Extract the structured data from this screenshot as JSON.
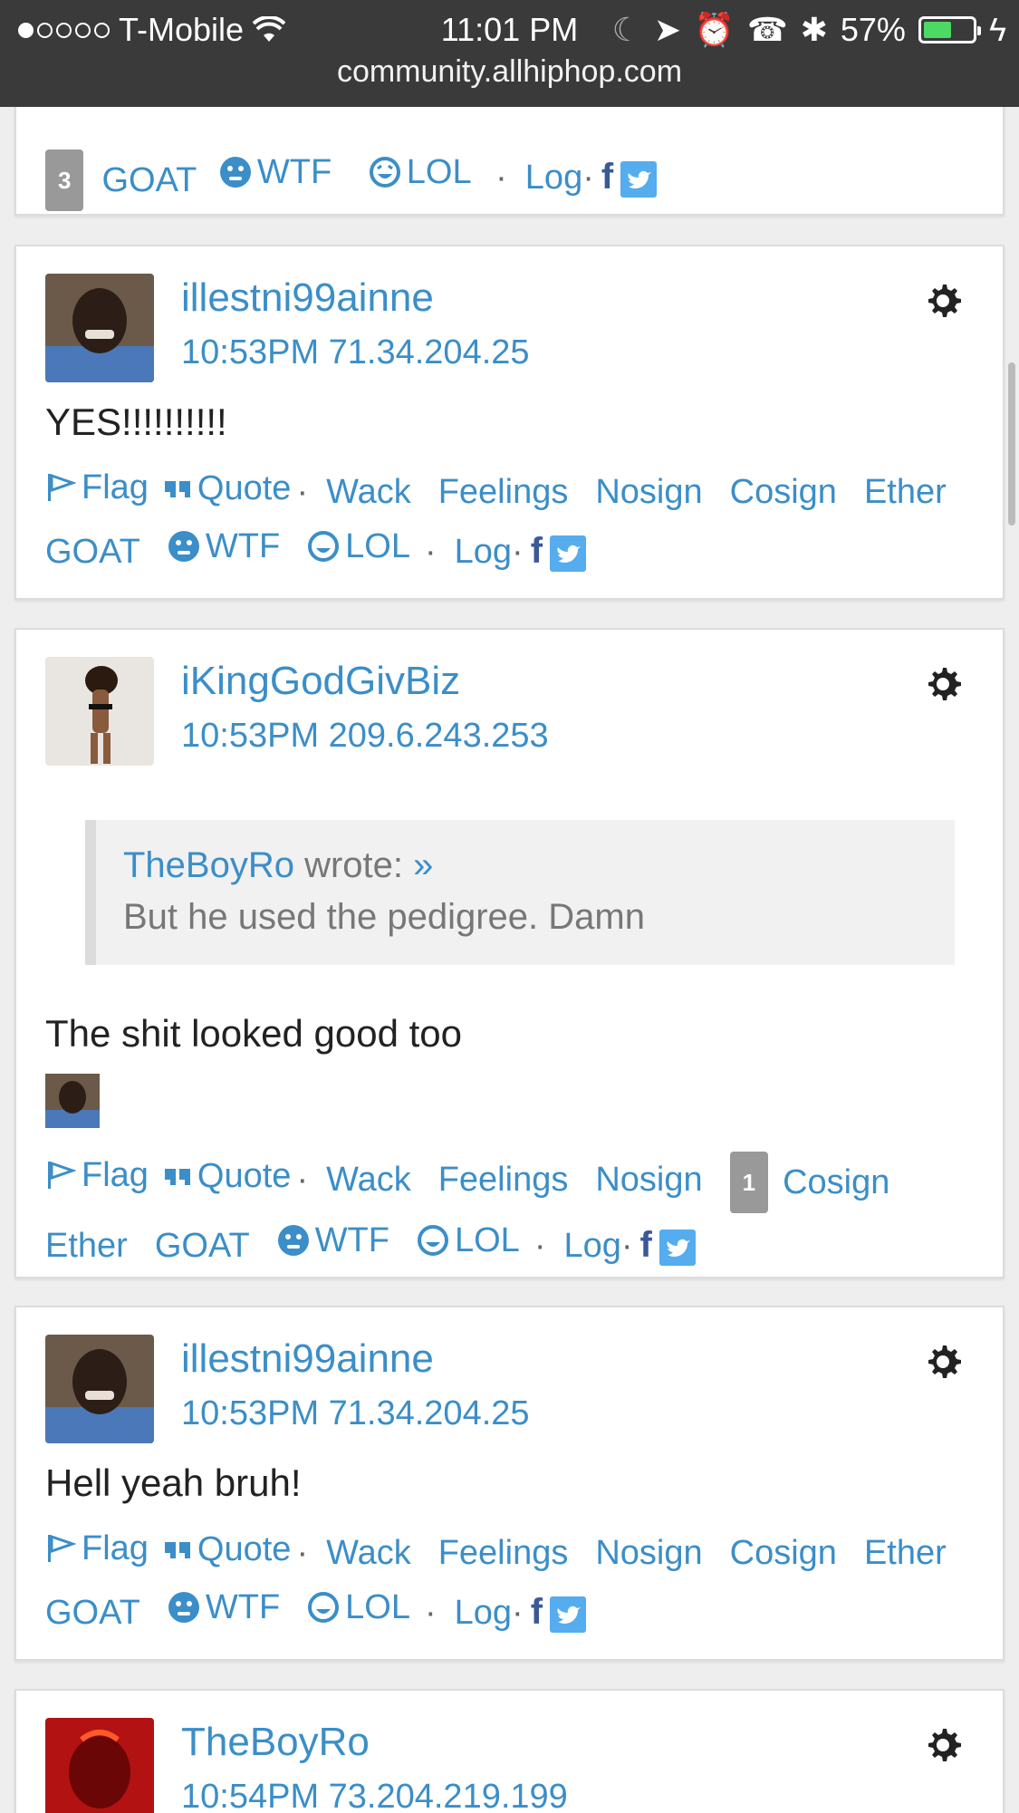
{
  "status": {
    "carrier": "T-Mobile",
    "time": "11:01 PM",
    "battery": "57%",
    "battery_level": 0.57,
    "url": "community.allhiphop.com"
  },
  "reactions": {
    "flag": "Flag",
    "quote": "Quote",
    "wack": "Wack",
    "feelings": "Feelings",
    "nosign": "Nosign",
    "cosign": "Cosign",
    "ether": "Ether",
    "goat": "GOAT",
    "wtf": "WTF",
    "lol": "LOL",
    "log": "Log",
    "fb": "f",
    "dot": "·"
  },
  "posts": [
    {
      "goat_count": "3"
    },
    {
      "username": "illestni99ainne",
      "meta": "10:53PM 71.34.204.25",
      "text": "YES!!!!!!!!!!"
    },
    {
      "username": "iKingGodGivBiz",
      "meta": "10:53PM 209.6.243.253",
      "quote_author": "TheBoyRo",
      "quote_wrote": " wrote: ",
      "quote_link": "»",
      "quote_text": "But he used the pedigree. Damn",
      "text": "The shit looked good too",
      "cosign_count": "1"
    },
    {
      "username": "illestni99ainne",
      "meta": "10:53PM 71.34.204.25",
      "text": "Hell yeah bruh!"
    },
    {
      "username": "TheBoyRo",
      "meta": "10:54PM 73.204.219.199"
    }
  ],
  "colors": {
    "link": "#3b8ec8",
    "status_bg": "#3a3a3a",
    "battery": "#4cd964",
    "twitter": "#55acee",
    "facebook": "#3b5998"
  }
}
